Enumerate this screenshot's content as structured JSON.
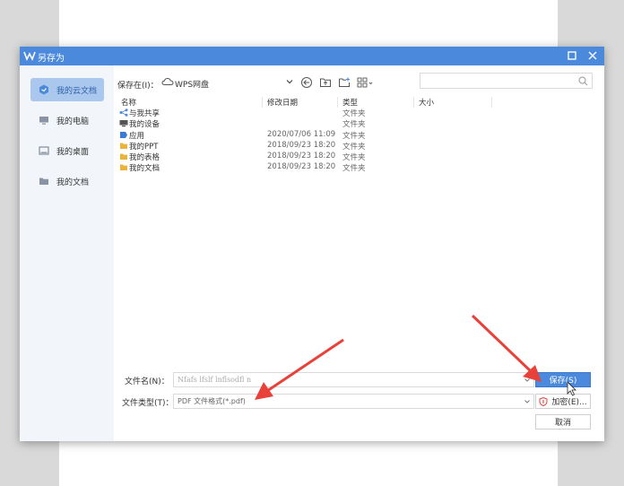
{
  "dialog": {
    "title": "另存为"
  },
  "sidebar": {
    "items": [
      {
        "label": "我的云文档",
        "icon": "cloud-doc-icon",
        "active": true
      },
      {
        "label": "我的电脑",
        "icon": "computer-icon"
      },
      {
        "label": "我的桌面",
        "icon": "desktop-icon"
      },
      {
        "label": "我的文档",
        "icon": "folder-icon"
      }
    ]
  },
  "location": {
    "label": "保存在(I)：",
    "value": "WPS网盘"
  },
  "search": {
    "placeholder": ""
  },
  "columns": {
    "name": "名称",
    "date": "修改日期",
    "type": "类型",
    "size": "大小"
  },
  "files": [
    {
      "name": "与我共享",
      "date": "",
      "type": "文件夹",
      "icon": "share-icon"
    },
    {
      "name": "我的设备",
      "date": "",
      "type": "文件夹",
      "icon": "device-icon"
    },
    {
      "name": "应用",
      "date": "2020/07/06 11:09",
      "type": "文件夹",
      "icon": "app-icon"
    },
    {
      "name": "我的PPT",
      "date": "2018/09/23 18:20",
      "type": "文件夹",
      "icon": "folder-icon"
    },
    {
      "name": "我的表格",
      "date": "2018/09/23 18:20",
      "type": "文件夹",
      "icon": "folder-icon"
    },
    {
      "name": "我的文档",
      "date": "2018/09/23 18:20",
      "type": "文件夹",
      "icon": "folder-icon"
    }
  ],
  "filename": {
    "label": "文件名(N)：",
    "value": "Nfafs lfslf lnflsodfl n"
  },
  "filetype": {
    "label": "文件类型(T)：",
    "value": "PDF 文件格式(*.pdf)"
  },
  "buttons": {
    "save": "保存(S)",
    "encrypt": "加密(E)...",
    "cancel": "取消"
  },
  "colors": {
    "accent": "#4a89dc",
    "arrow": "#e8413a",
    "sidebar_bg": "#f2f5fa"
  }
}
